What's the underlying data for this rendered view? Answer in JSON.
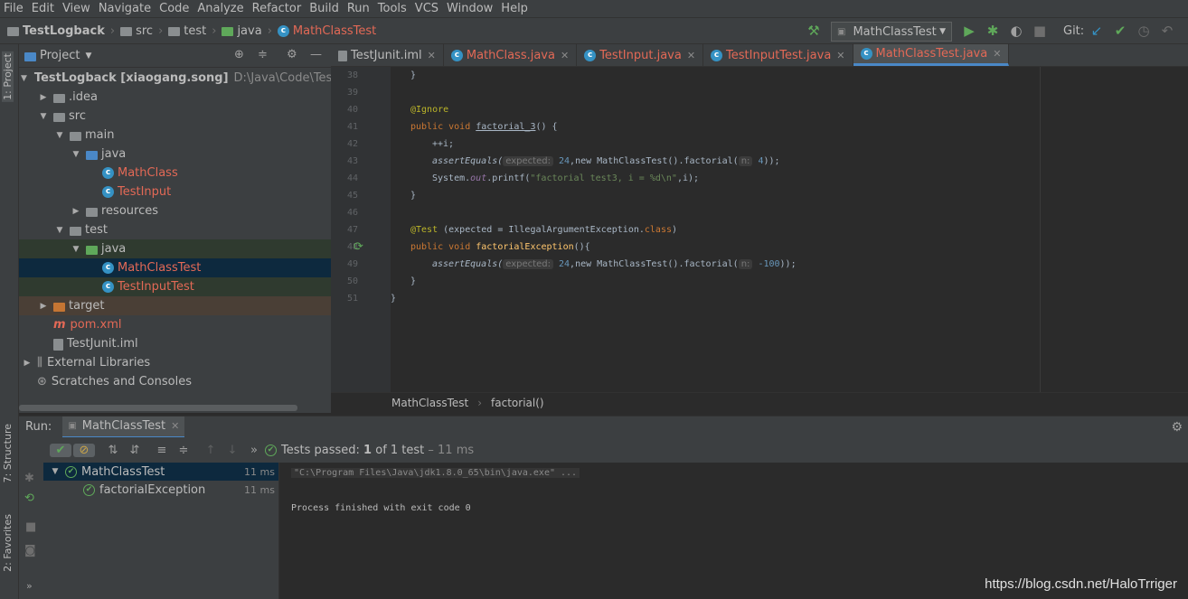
{
  "menu": [
    "File",
    "Edit",
    "View",
    "Navigate",
    "Code",
    "Analyze",
    "Refactor",
    "Build",
    "Run",
    "Tools",
    "VCS",
    "Window",
    "Help"
  ],
  "nav": {
    "project": "TestLogback",
    "crumbs": [
      "src",
      "test",
      "java",
      "MathClassTest"
    ],
    "run_config": "MathClassTest",
    "git_label": "Git:"
  },
  "left_tabs": {
    "project": "1: Project",
    "structure": "7: Structure",
    "favorites": "2: Favorites"
  },
  "project_panel": {
    "title": "Project",
    "root": "TestLogback [xiaogang.song]",
    "root_path": "D:\\Java\\Code\\TestLo",
    "items": [
      ".idea",
      "src",
      "main",
      "java",
      "MathClass",
      "TestInput",
      "resources",
      "test",
      "java",
      "MathClassTest",
      "TestInputTest",
      "target",
      "pom.xml",
      "TestJunit.iml",
      "External Libraries",
      "Scratches and Consoles"
    ]
  },
  "tabs": [
    "TestJunit.iml",
    "MathClass.java",
    "TestInput.java",
    "TestInputTest.java",
    "MathClassTest.java"
  ],
  "lines": [
    "38",
    "39",
    "40",
    "41",
    "42",
    "43",
    "44",
    "45",
    "46",
    "47",
    "48",
    "49",
    "50",
    "51"
  ],
  "code": {
    "l38": "}",
    "l40": "@Ignore",
    "l41a": "public void ",
    "l41b": "factorial_3",
    "l41c": "() {",
    "l42": "++i;",
    "l43a": "assertEquals(",
    "l43h": "expected:",
    "l43n": "24",
    "l43b": ",new MathClassTest().factorial(",
    "l43h2": "n:",
    "l43n2": "4",
    "l43c": "));",
    "l44a": "System.",
    "l44b": "out",
    "l44c": ".printf(",
    "l44s": "\"factorial test3, i = %d\\n\"",
    "l44d": ",i);",
    "l45": "}",
    "l47a": "@Test ",
    "l47b": "(expected = IllegalArgumentException.",
    "l47c": "class",
    "l47d": ")",
    "l48a": "public void ",
    "l48b": "factorialException",
    "l48c": "(){",
    "l49a": "assertEquals(",
    "l49h": "expected:",
    "l49n": "24",
    "l49b": ",new MathClassTest().factorial(",
    "l49h2": "n:",
    "l49n2": "-100",
    "l49c": "));",
    "l50": "}",
    "l51": "}"
  },
  "editor_breadcrumb": [
    "MathClassTest",
    "factorial()"
  ],
  "run": {
    "label": "Run:",
    "tab": "MathClassTest",
    "status_prefix": "Tests passed:",
    "status_count": "1",
    "status_of": "of 1 test",
    "status_time": "– 11 ms",
    "tree": [
      {
        "name": "MathClassTest",
        "time": "11 ms"
      },
      {
        "name": "factorialException",
        "time": "11 ms"
      }
    ],
    "console": [
      "\"C:\\Program Files\\Java\\jdk1.8.0_65\\bin\\java.exe\" ...",
      "Process finished with exit code 0"
    ]
  },
  "watermark": "https://blog.csdn.net/HaloTrriger"
}
